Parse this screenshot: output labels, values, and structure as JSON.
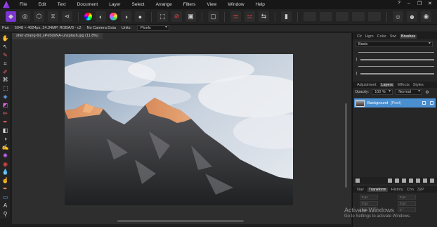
{
  "menu": [
    "File",
    "Edit",
    "Text",
    "Document",
    "Layer",
    "Select",
    "Arrange",
    "Filters",
    "View",
    "Window",
    "Help"
  ],
  "window_controls": [
    "?",
    "–",
    "❐",
    "✕"
  ],
  "context": {
    "tool": "Pan",
    "info": "6048 × 4024px, 24.34MP, RGBA/8 - c2",
    "camera": "No Camera Data",
    "units_label": "Units:",
    "units_value": "Pixels"
  },
  "document_tab": "sher-zhang-6il_sPe5dsNA-unsplash.jpg (11.8%)",
  "panels": {
    "top_tabs": [
      "Clr",
      "Hgm",
      "Color",
      "Swt",
      "Brushes"
    ],
    "brush_category": "Basic",
    "stroke_labels": [
      "",
      "1",
      "",
      "1"
    ],
    "mid_tabs": [
      "Adjustment",
      "Layers",
      "Effects",
      "Styles"
    ],
    "opacity_label": "Opacity:",
    "opacity_value": "100 %",
    "blend_mode": "Normal",
    "layer_name": "Background",
    "layer_type": "(Pixel)",
    "bottom_tabs": [
      "Nav",
      "Transform",
      "History",
      "Chn",
      "32P"
    ],
    "transform_fields": [
      "0 px",
      "0 px",
      "0 px",
      "0 px",
      "0 px",
      "0 °"
    ]
  },
  "watermark": {
    "title": "Activate Windows",
    "subtitle": "Go to Settings to activate Windows."
  },
  "colors": {
    "accent": "#4a8fd0",
    "brand": "#8a3ee0"
  }
}
